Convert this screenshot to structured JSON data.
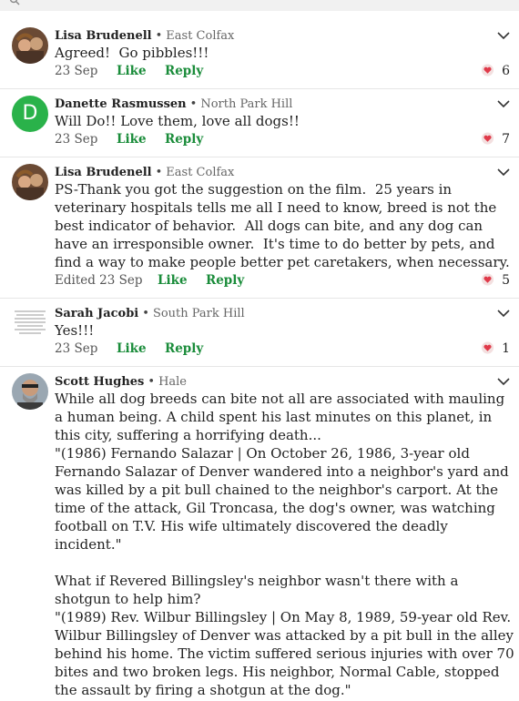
{
  "colors": {
    "accent": "#1a8c3a",
    "heart": "#e03a4a",
    "avatar_green": "#2ab24a"
  },
  "comments": [
    {
      "author": "Lisa Brudenell",
      "neighborhood": "East Colfax",
      "text": "Agreed!  Go pibbles!!!",
      "date": "23 Sep",
      "like_label": "Like",
      "reply_label": "Reply",
      "likes": "6",
      "avatar": "photo"
    },
    {
      "author": "Danette Rasmussen",
      "neighborhood": "North Park Hill",
      "text": "Will Do!! Love them, love all dogs!!",
      "date": "23 Sep",
      "like_label": "Like",
      "reply_label": "Reply",
      "likes": "7",
      "avatar": "letter",
      "avatar_letter": "D"
    },
    {
      "author": "Lisa Brudenell",
      "neighborhood": "East Colfax",
      "text": "PS-Thank you got the suggestion on the film.  25 years in veterinary hospitals tells me all I need to know, breed is not the best indicator of behavior.  All dogs can bite, and any dog can have an irresponsible owner.  It's time to do better by pets, and find a way to make people better pet caretakers, when necessary.",
      "date": "Edited 23 Sep",
      "like_label": "Like",
      "reply_label": "Reply",
      "likes": "5",
      "avatar": "photo"
    },
    {
      "author": "Sarah Jacobi",
      "neighborhood": "South Park Hill",
      "text": "Yes!!!",
      "date": "23 Sep",
      "like_label": "Like",
      "reply_label": "Reply",
      "likes": "1",
      "avatar": "document"
    },
    {
      "author": "Scott Hughes",
      "neighborhood": "Hale",
      "text": "While all dog breeds can bite not all are associated with mauling a human being. A child spent his last minutes on this planet, in this city, suffering a horrifying death...\n\"(1986) Fernando Salazar | On October 26, 1986, 3-year old Fernando Salazar of Denver wandered into a neighbor's yard and was killed by a pit bull chained to the neighbor's carport. At the time of the attack, Gil Troncasa, the dog's owner, was watching football on T.V. His wife ultimately discovered the deadly incident.\"\n\nWhat if Revered Billingsley's neighbor wasn't there with a shotgun to help him?\n\"(1989) Rev. Wilbur Billingsley | On May 8, 1989, 59-year old Rev. Wilbur Billingsley of Denver was attacked by a pit bull in the alley behind his home. The victim suffered serious injuries with over 70 bites and two broken legs. His neighbor, Normal Cable, stopped the assault by firing a shotgun at the dog.\"",
      "avatar": "photo-man"
    }
  ]
}
